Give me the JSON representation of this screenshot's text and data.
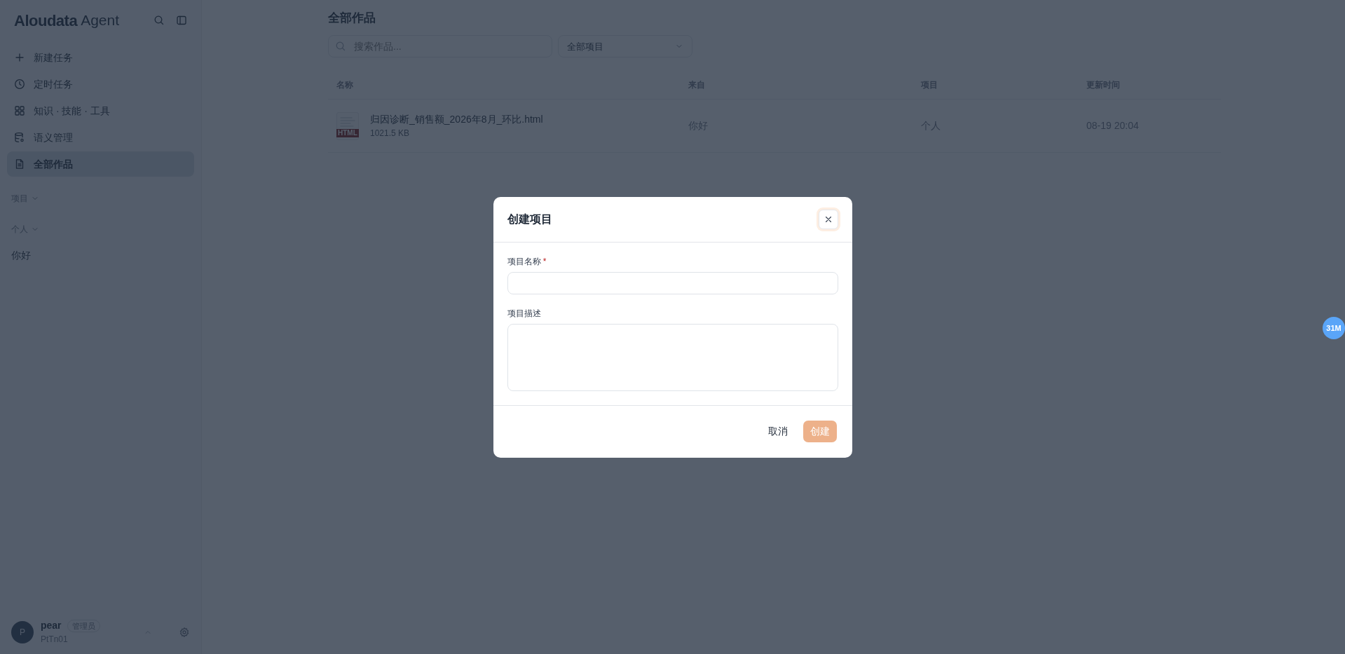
{
  "brand": {
    "name": "Aloudata",
    "suffix": "Agent"
  },
  "nav": [
    {
      "kind": "plus",
      "label": "新建任务",
      "selected": false
    },
    {
      "kind": "clock",
      "label": "定时任务",
      "selected": false
    },
    {
      "kind": "grid",
      "label": "知识 · 技能 · 工具",
      "selected": false
    },
    {
      "kind": "database",
      "label": "语义管理",
      "selected": false
    },
    {
      "kind": "document",
      "label": "全部作品",
      "selected": true
    }
  ],
  "sections": [
    {
      "label": "项目"
    },
    {
      "label": "个人",
      "items": [
        "你好"
      ]
    }
  ],
  "user": {
    "initial": "P",
    "name": "pear",
    "role": "管理员",
    "account": "PtTn01"
  },
  "main": {
    "title": "全部作品",
    "search": {
      "placeholder": "搜索作品..."
    },
    "filter": "全部项目",
    "table": {
      "columns": [
        "名称",
        "来自",
        "项目",
        "更新时间"
      ],
      "rows": [
        {
          "file_type": "HTML",
          "name": "归因诊断_销售额_2026年8月_环比.html",
          "size": "1021.5 KB",
          "from": "你好",
          "project": "个人",
          "updated": "08-19 20:04"
        }
      ]
    }
  },
  "dialog": {
    "title": "创建项目",
    "fields": [
      {
        "kind": "input",
        "label": "项目名称",
        "required_mark": "*"
      },
      {
        "kind": "textarea",
        "label": "项目描述"
      }
    ],
    "cancel": "取消",
    "submit": "创建"
  },
  "floating_badge": "31M"
}
